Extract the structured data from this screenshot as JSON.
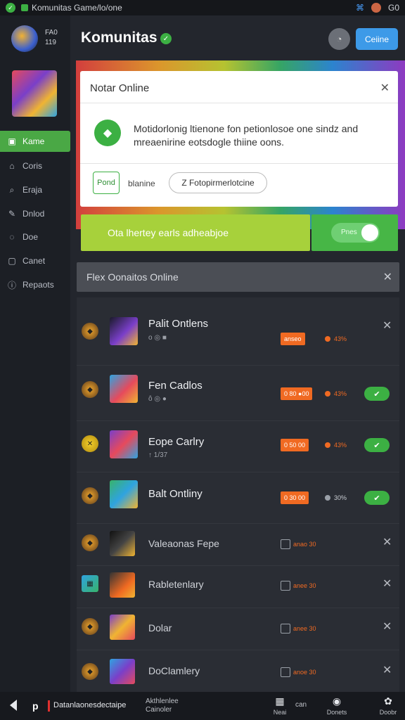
{
  "status": {
    "title": "Komunitas Game/lo/one",
    "right_icons": [
      "link-icon",
      "avatar",
      "G0"
    ]
  },
  "sidebar": {
    "code": [
      "FA0",
      "119"
    ],
    "items": [
      {
        "label": "Kame",
        "icon": "calendar-icon",
        "active": true
      },
      {
        "label": "Coris",
        "icon": "bag-icon",
        "active": false
      },
      {
        "label": "Eraja",
        "icon": "search-icon",
        "active": false
      },
      {
        "label": "Dnlod",
        "icon": "pen-icon",
        "active": false
      },
      {
        "label": "Doe",
        "icon": "chat-icon",
        "active": false
      },
      {
        "label": "Canet",
        "icon": "doc-icon",
        "active": false
      },
      {
        "label": "Repaots",
        "icon": "info-icon",
        "active": false
      }
    ]
  },
  "header": {
    "title": "Komunitas",
    "online_button": "Ceiine"
  },
  "modal": {
    "title": "Notar Online",
    "text": "Motidorlonig ltienone fon petionlosoe one sindz and mreaenirine eotsdogle thiine oons.",
    "button1": "Pond",
    "button1_label": "blanine",
    "button2": "Z  Fotopirmerlotcine"
  },
  "banner": {
    "text": "Ota lhertey earls adheabjoe",
    "toggle_label": "Pnes"
  },
  "list": {
    "header": "Flex Oonaitos Online",
    "rows": [
      {
        "name": "Palit Ontlens",
        "sub": "o ◎ ■",
        "tag": "anseo",
        "pct": "43%",
        "ok": false
      },
      {
        "name": "Fen Cadlos",
        "sub": "ô ◎ ●",
        "tag": "0 80 ●00",
        "pct": "43%",
        "ok": true
      },
      {
        "name": "Eope Carlry",
        "sub": "↑ 1/37",
        "tag": "0 50 00",
        "pct": "43%",
        "ok": true
      },
      {
        "name": "Balt Ontliny",
        "sub": "",
        "tag": "0 30 00",
        "pct": "30%",
        "ok": true
      },
      {
        "name": "Valeaonas Fepe",
        "sub": "",
        "tag": "anao 30",
        "pct": "",
        "ok": false
      },
      {
        "name": "Rabletenlary",
        "sub": "",
        "tag": "anee 30",
        "pct": "",
        "ok": false
      },
      {
        "name": "Dolar",
        "sub": "",
        "tag": "anee 30",
        "pct": "",
        "ok": false
      },
      {
        "name": "DoClamlery",
        "sub": "",
        "tag": "anoe 30",
        "pct": "",
        "ok": false
      }
    ]
  },
  "bottom": {
    "p": "p",
    "current": "Datanlaonesdectaipe",
    "mid": [
      "Akthlenlee",
      "Cainoler"
    ],
    "nav": [
      {
        "label": "Neai",
        "glyph": "▦"
      },
      {
        "label": "Donets",
        "glyph": "◉"
      },
      {
        "label": "Doobr",
        "glyph": "✿"
      }
    ],
    "nav_extra": "can"
  }
}
